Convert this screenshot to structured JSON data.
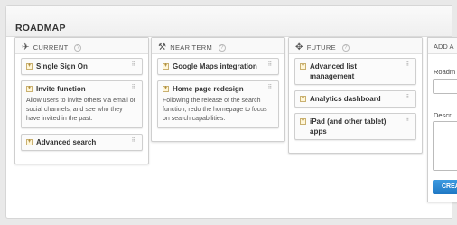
{
  "panel": {
    "title": "ROADMAP"
  },
  "columns": [
    {
      "name": "CURRENT",
      "icon": "pin-icon",
      "cards": [
        {
          "title": "Single Sign On",
          "description": ""
        },
        {
          "title": "Invite function",
          "description": "Allow users to invite others via email or social channels, and see who they have invited in the past."
        },
        {
          "title": "Advanced search",
          "description": ""
        }
      ]
    },
    {
      "name": "NEAR TERM",
      "icon": "wrench-icon",
      "cards": [
        {
          "title": "Google Maps integration",
          "description": ""
        },
        {
          "title": "Home page redesign",
          "description": "Following the release of the search function, redo the homepage to focus on search capabilities."
        }
      ]
    },
    {
      "name": "FUTURE",
      "icon": "signpost-icon",
      "cards": [
        {
          "title": "Advanced list management",
          "description": ""
        },
        {
          "title": "Analytics dashboard",
          "description": ""
        },
        {
          "title": "iPad (and other tablet) apps",
          "description": ""
        }
      ]
    }
  ],
  "form": {
    "header": "ADD A",
    "name_label": "Roadm",
    "description_label": "Descr",
    "create_label": "CREA"
  },
  "glyphs": {
    "expander": "+",
    "grip": "⠿",
    "help": "?",
    "pin": "✈",
    "wrench": "⚒",
    "signpost": "✥"
  }
}
